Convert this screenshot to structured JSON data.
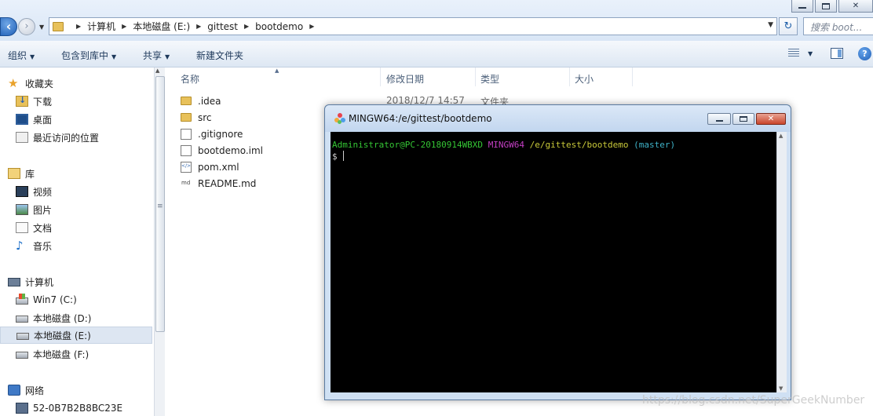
{
  "explorer": {
    "breadcrumbs": [
      "计算机",
      "本地磁盘 (E:)",
      "gittest",
      "bootdemo"
    ],
    "search_placeholder": "搜索 boot...",
    "toolbar": {
      "organize": "组织",
      "include_in_library": "包含到库中",
      "share": "共享",
      "new_folder": "新建文件夹"
    },
    "nav": {
      "favorites": {
        "label": "收藏夹",
        "items": [
          "下载",
          "桌面",
          "最近访问的位置"
        ]
      },
      "libraries": {
        "label": "库",
        "items": [
          "视频",
          "图片",
          "文档",
          "音乐"
        ]
      },
      "computer": {
        "label": "计算机",
        "items": [
          "Win7 (C:)",
          "本地磁盘 (D:)",
          "本地磁盘 (E:)",
          "本地磁盘 (F:)"
        ]
      },
      "network": {
        "label": "网络",
        "items": [
          "52-0B7B2B8BC23E"
        ]
      }
    },
    "columns": [
      "名称",
      "修改日期",
      "类型",
      "大小"
    ],
    "files": [
      {
        "name": ".idea",
        "kind": "folder",
        "date": "2018/12/7 14:57",
        "type": "文件夹"
      },
      {
        "name": "src",
        "kind": "folder"
      },
      {
        "name": ".gitignore",
        "kind": "file"
      },
      {
        "name": "bootdemo.iml",
        "kind": "file"
      },
      {
        "name": "pom.xml",
        "kind": "xml"
      },
      {
        "name": "README.md",
        "kind": "md"
      }
    ]
  },
  "terminal": {
    "title": "MINGW64:/e/gittest/bootdemo",
    "prompt": {
      "user_host": "Administrator@PC-20180914WBXD",
      "system": "MINGW64",
      "path": "/e/gittest/bootdemo",
      "branch": "(master)",
      "symbol": "$"
    }
  },
  "watermark": "https://blog.csdn.net/SuperGeekNumber",
  "colors": {
    "term_user": "#35c635",
    "term_system": "#c43fc4",
    "term_path": "#c9c93a",
    "term_branch": "#3fb3c9",
    "term_bg": "#000000"
  }
}
